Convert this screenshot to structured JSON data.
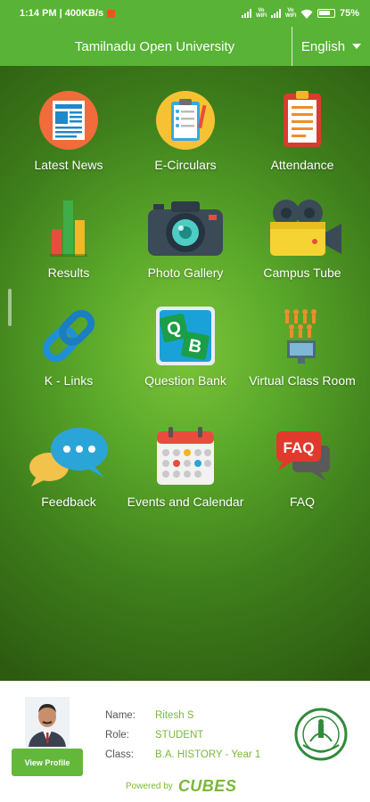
{
  "status_bar": {
    "time_speed": "1:14 PM | 400KB/s",
    "network_labels": [
      "Vo\nWiFi",
      "Vo\nWiFi"
    ],
    "battery": "75%"
  },
  "header": {
    "title": "Tamilnadu Open University",
    "language": "English"
  },
  "tiles": [
    {
      "label": "Latest News",
      "icon": "news-icon"
    },
    {
      "label": "E-Circulars",
      "icon": "clipboard-checklist-icon"
    },
    {
      "label": "Attendance",
      "icon": "attendance-icon"
    },
    {
      "label": "Results",
      "icon": "bar-chart-icon"
    },
    {
      "label": "Photo Gallery",
      "icon": "camera-icon"
    },
    {
      "label": "Campus Tube",
      "icon": "video-camera-icon"
    },
    {
      "label": "K - Links",
      "icon": "link-icon"
    },
    {
      "label": "Question Bank",
      "icon": "question-bank-icon",
      "badge": [
        "Q",
        "B"
      ]
    },
    {
      "label": "Virtual Class Room",
      "icon": "virtual-classroom-icon"
    },
    {
      "label": "Feedback",
      "icon": "chat-bubbles-icon"
    },
    {
      "label": "Events and Calendar",
      "icon": "calendar-icon"
    },
    {
      "label": "FAQ",
      "icon": "faq-bubble-icon",
      "badge_text": "FAQ"
    }
  ],
  "profile": {
    "view_profile_label": "View Profile",
    "name_key": "Name:",
    "name": "Ritesh S",
    "role_key": "Role:",
    "role": "STUDENT",
    "class_key": "Class:",
    "class": "B.A. HISTORY - Year 1"
  },
  "powered_by": {
    "label": "Powered by",
    "brand": "CUBES"
  },
  "colors": {
    "brand_green": "#58b336",
    "value_green": "#7ab838"
  }
}
